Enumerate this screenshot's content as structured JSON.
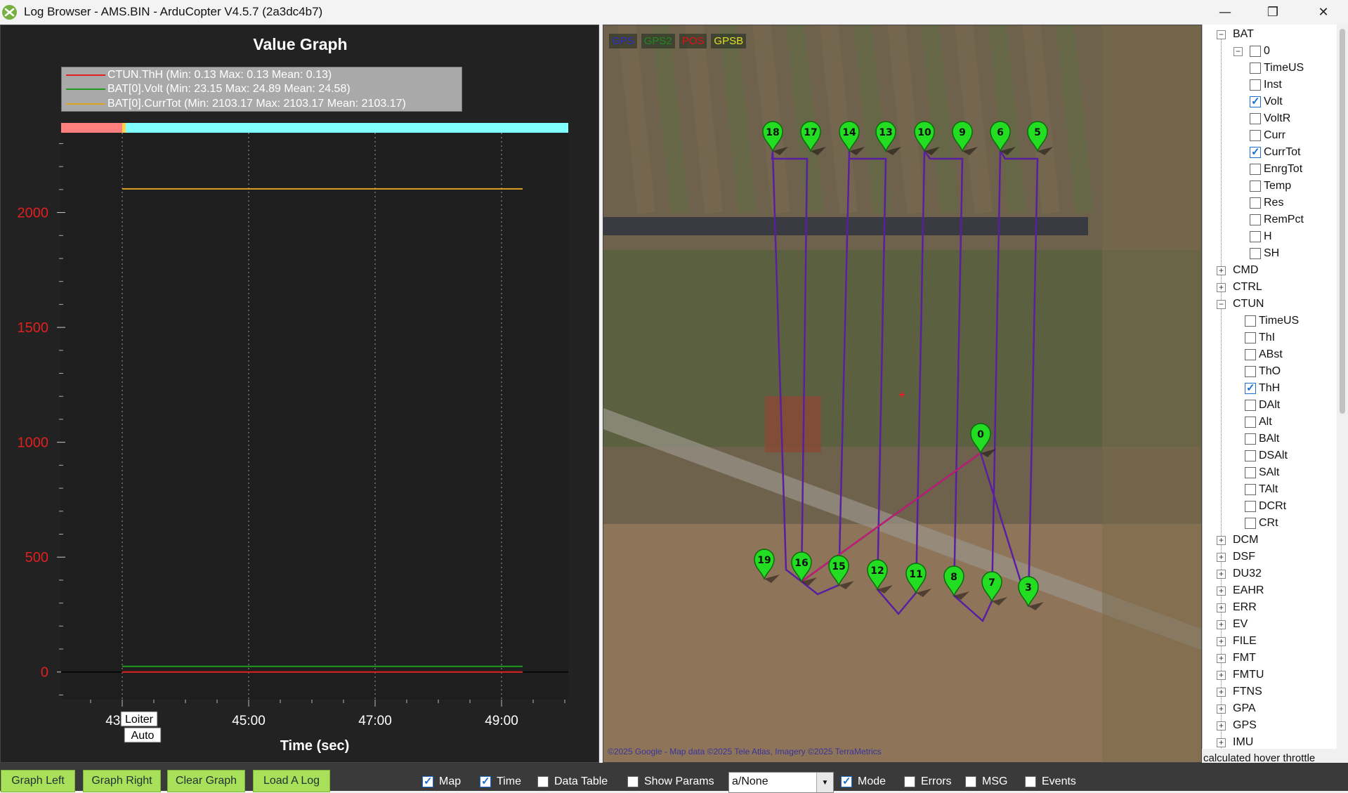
{
  "window": {
    "title": "Log Browser - AMS.BIN - ArduCopter V4.5.7 (2a3dc4b7)",
    "icon": "ardupilot-log-icon",
    "controls": {
      "minimize": "—",
      "maximize": "❐",
      "close": "✕"
    }
  },
  "graph": {
    "title": "Value Graph",
    "legend": [
      {
        "label": "CTUN.ThH  (Min: 0.13 Max: 0.13 Mean: 0.13)",
        "color": "#e02020"
      },
      {
        "label": "BAT[0].Volt  (Min: 23.15 Max: 24.89 Mean: 24.58)",
        "color": "#1f9a1f"
      },
      {
        "label": "BAT[0].CurrTot  (Min: 2103.17 Max: 2103.17 Mean: 2103.17)",
        "color": "#e0a020"
      }
    ],
    "mode_labels": [
      "Loiter",
      "Auto"
    ]
  },
  "chart_data": {
    "type": "line",
    "xlabel": "Time (sec)",
    "ylabel": "",
    "x_ticks": [
      "43:00",
      "45:00",
      "47:00",
      "49:00"
    ],
    "y_ticks": [
      "0",
      "500",
      "1000",
      "1500",
      "2000"
    ],
    "ylim": [
      -120,
      2390
    ],
    "series": [
      {
        "name": "CTUN.ThH",
        "color": "#e02020",
        "x": [
          "43:00",
          "49:20"
        ],
        "y": [
          0.13,
          0.13
        ]
      },
      {
        "name": "BAT[0].Volt",
        "color": "#1f9a1f",
        "x": [
          "43:00",
          "49:20"
        ],
        "y": [
          24.58,
          24.58
        ]
      },
      {
        "name": "BAT[0].CurrTot",
        "color": "#e0a020",
        "x": [
          "43:00",
          "49:20"
        ],
        "y": [
          2103.17,
          2103.17
        ]
      }
    ],
    "mode_bar": [
      {
        "mode": "Loiter",
        "color": "#ff7f7f"
      },
      {
        "mode": "Auto",
        "color": "#80ffff"
      }
    ],
    "grid": true,
    "legend_position": "top-left"
  },
  "map": {
    "legend": [
      {
        "label": "GPS",
        "color": "#2a2ac8"
      },
      {
        "label": "GPS2",
        "color": "#1e8a1e"
      },
      {
        "label": "POS",
        "color": "#e01010"
      },
      {
        "label": "GPSB",
        "color": "#e0e020"
      }
    ],
    "copyright": "©2025 Google - Map data ©2025 Tele Atlas, Imagery ©2025 TerraMetrics",
    "waypoints": [
      "0",
      "3",
      "5",
      "6",
      "7",
      "8",
      "9",
      "10",
      "11",
      "12",
      "13",
      "14",
      "15",
      "16",
      "17",
      "18",
      "19"
    ]
  },
  "tree": {
    "items": [
      {
        "label": "BAT",
        "level": 0,
        "expander": "−"
      },
      {
        "label": "0",
        "level": 1,
        "expander": "−",
        "checkbox": true,
        "checked": false
      },
      {
        "label": "TimeUS",
        "level": 2,
        "checkbox": true,
        "checked": false
      },
      {
        "label": "Inst",
        "level": 2,
        "checkbox": true,
        "checked": false
      },
      {
        "label": "Volt",
        "level": 2,
        "checkbox": true,
        "checked": true
      },
      {
        "label": "VoltR",
        "level": 2,
        "checkbox": true,
        "checked": false
      },
      {
        "label": "Curr",
        "level": 2,
        "checkbox": true,
        "checked": false
      },
      {
        "label": "CurrTot",
        "level": 2,
        "checkbox": true,
        "checked": true
      },
      {
        "label": "EnrgTot",
        "level": 2,
        "checkbox": true,
        "checked": false
      },
      {
        "label": "Temp",
        "level": 2,
        "checkbox": true,
        "checked": false
      },
      {
        "label": "Res",
        "level": 2,
        "checkbox": true,
        "checked": false
      },
      {
        "label": "RemPct",
        "level": 2,
        "checkbox": true,
        "checked": false
      },
      {
        "label": "H",
        "level": 2,
        "checkbox": true,
        "checked": false
      },
      {
        "label": "SH",
        "level": 2,
        "checkbox": true,
        "checked": false
      },
      {
        "label": "CMD",
        "level": 0,
        "expander": "+"
      },
      {
        "label": "CTRL",
        "level": 0,
        "expander": "+"
      },
      {
        "label": "CTUN",
        "level": 0,
        "expander": "−"
      },
      {
        "label": "TimeUS",
        "level": 1,
        "checkbox": true,
        "checked": false
      },
      {
        "label": "ThI",
        "level": 1,
        "checkbox": true,
        "checked": false
      },
      {
        "label": "ABst",
        "level": 1,
        "checkbox": true,
        "checked": false
      },
      {
        "label": "ThO",
        "level": 1,
        "checkbox": true,
        "checked": false
      },
      {
        "label": "ThH",
        "level": 1,
        "checkbox": true,
        "checked": true
      },
      {
        "label": "DAlt",
        "level": 1,
        "checkbox": true,
        "checked": false
      },
      {
        "label": "Alt",
        "level": 1,
        "checkbox": true,
        "checked": false
      },
      {
        "label": "BAlt",
        "level": 1,
        "checkbox": true,
        "checked": false
      },
      {
        "label": "DSAlt",
        "level": 1,
        "checkbox": true,
        "checked": false
      },
      {
        "label": "SAlt",
        "level": 1,
        "checkbox": true,
        "checked": false
      },
      {
        "label": "TAlt",
        "level": 1,
        "checkbox": true,
        "checked": false
      },
      {
        "label": "DCRt",
        "level": 1,
        "checkbox": true,
        "checked": false
      },
      {
        "label": "CRt",
        "level": 1,
        "checkbox": true,
        "checked": false
      },
      {
        "label": "DCM",
        "level": 0,
        "expander": "+"
      },
      {
        "label": "DSF",
        "level": 0,
        "expander": "+"
      },
      {
        "label": "DU32",
        "level": 0,
        "expander": "+"
      },
      {
        "label": "EAHR",
        "level": 0,
        "expander": "+"
      },
      {
        "label": "ERR",
        "level": 0,
        "expander": "+"
      },
      {
        "label": "EV",
        "level": 0,
        "expander": "+"
      },
      {
        "label": "FILE",
        "level": 0,
        "expander": "+"
      },
      {
        "label": "FMT",
        "level": 0,
        "expander": "+"
      },
      {
        "label": "FMTU",
        "level": 0,
        "expander": "+"
      },
      {
        "label": "FTNS",
        "level": 0,
        "expander": "+"
      },
      {
        "label": "GPA",
        "level": 0,
        "expander": "+"
      },
      {
        "label": "GPS",
        "level": 0,
        "expander": "+"
      },
      {
        "label": "IMU",
        "level": 0,
        "expander": "+"
      }
    ],
    "description": "calculated hover throttle"
  },
  "bottombar": {
    "buttons": [
      "Graph Left",
      "Graph Right",
      "Clear Graph",
      "Load A Log"
    ],
    "checks": [
      {
        "label": "Map",
        "checked": true
      },
      {
        "label": "Time",
        "checked": true
      },
      {
        "label": "Data Table",
        "checked": false
      },
      {
        "label": "Show Params",
        "checked": false
      },
      {
        "label": "Mode",
        "checked": true
      },
      {
        "label": "Errors",
        "checked": false
      },
      {
        "label": "MSG",
        "checked": false
      },
      {
        "label": "Events",
        "checked": false
      }
    ],
    "mode_select_value": "a/None"
  }
}
